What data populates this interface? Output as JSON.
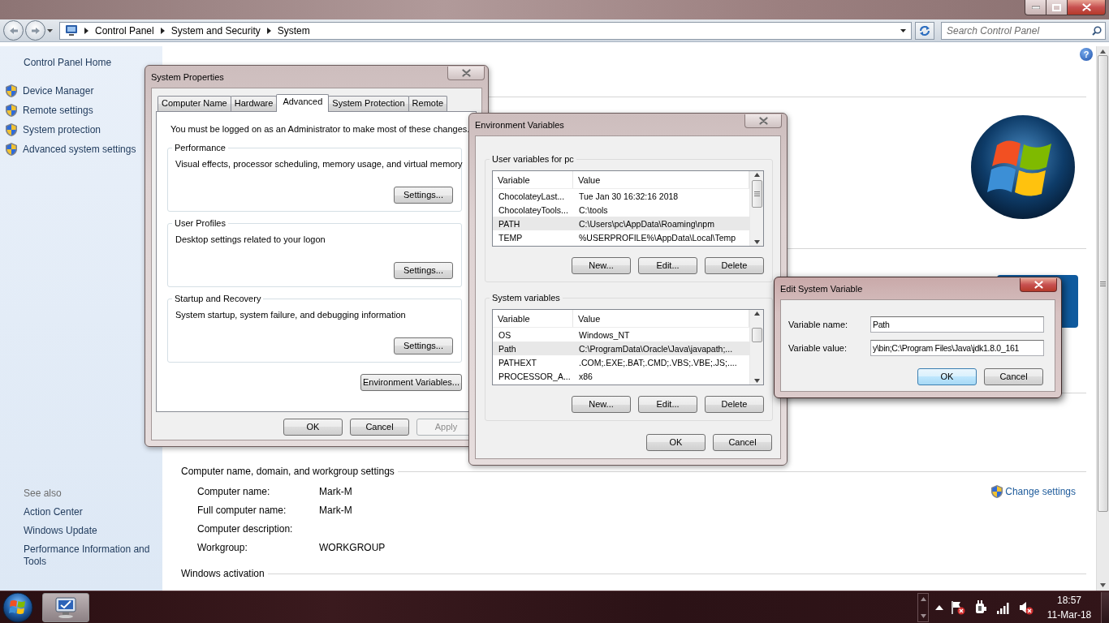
{
  "address_bar": {
    "breadcrumb": [
      "Control Panel",
      "System and Security",
      "System"
    ],
    "search": {
      "placeholder": "Search Control Panel"
    }
  },
  "help": "?",
  "sidebar": {
    "home": "Control Panel Home",
    "tasks": [
      "Device Manager",
      "Remote settings",
      "System protection",
      "Advanced system settings"
    ],
    "see_also": {
      "title": "See also",
      "links": [
        "Action Center",
        "Windows Update",
        "Performance Information and Tools"
      ]
    }
  },
  "content": {
    "computer_name": {
      "title": "Computer name, domain, and workgroup settings",
      "action": "Change settings",
      "rows": [
        {
          "label": "Computer name:",
          "value": "Mark-M"
        },
        {
          "label": "Full computer name:",
          "value": "Mark-M"
        },
        {
          "label": "Computer description:"
        },
        {
          "label": "Workgroup:",
          "value": "WORKGROUP"
        }
      ]
    },
    "activation": {
      "title": "Windows activation"
    }
  },
  "system_properties": {
    "title": "System Properties",
    "tabs": [
      {
        "label": "Computer Name",
        "selected": false
      },
      {
        "label": "Hardware",
        "selected": false
      },
      {
        "label": "Advanced",
        "selected": true
      },
      {
        "label": "System Protection",
        "selected": false
      },
      {
        "label": "Remote",
        "selected": false
      }
    ],
    "notice": "You must be logged on as an Administrator to make most of these changes.",
    "groups": [
      {
        "title": "Performance",
        "description": "Visual effects, processor scheduling, memory usage, and virtual memory",
        "button": "Settings..."
      },
      {
        "title": "User Profiles",
        "description": "Desktop settings related to your logon",
        "button": "Settings..."
      },
      {
        "title": "Startup and Recovery",
        "description": "System startup, system failure, and debugging information",
        "button": "Settings..."
      }
    ],
    "env_button": "Environment Variables...",
    "buttons": [
      {
        "label": "OK",
        "disabled": false
      },
      {
        "label": "Cancel",
        "disabled": false
      },
      {
        "label": "Apply",
        "disabled": true
      }
    ]
  },
  "environment_variables": {
    "title": "Environment Variables",
    "groups": [
      {
        "title": "User variables for pc",
        "columns": [
          "Variable",
          "Value"
        ],
        "rows": [
          {
            "variable": "ChocolateyLast...",
            "value": "Tue Jan 30 16:32:16 2018",
            "selected": false
          },
          {
            "variable": "ChocolateyTools...",
            "value": "C:\\tools",
            "selected": false
          },
          {
            "variable": "PATH",
            "value": "C:\\Users\\pc\\AppData\\Roaming\\npm",
            "selected": true
          },
          {
            "variable": "TEMP",
            "value": "%USERPROFILE%\\AppData\\Local\\Temp",
            "selected": false
          }
        ],
        "buttons": [
          "New...",
          "Edit...",
          "Delete"
        ]
      },
      {
        "title": "System variables",
        "columns": [
          "Variable",
          "Value"
        ],
        "rows": [
          {
            "variable": "OS",
            "value": "Windows_NT",
            "selected": false
          },
          {
            "variable": "Path",
            "value": "C:\\ProgramData\\Oracle\\Java\\javapath;...",
            "selected": true
          },
          {
            "variable": "PATHEXT",
            "value": ".COM;.EXE;.BAT;.CMD;.VBS;.VBE;.JS;....",
            "selected": false
          },
          {
            "variable": "PROCESSOR_A...",
            "value": "x86",
            "selected": false
          }
        ],
        "buttons": [
          "New...",
          "Edit...",
          "Delete"
        ]
      }
    ],
    "buttons": [
      "OK",
      "Cancel"
    ]
  },
  "edit_variable": {
    "title": "Edit System Variable",
    "fields": [
      {
        "label": "Variable name:",
        "value": "Path"
      },
      {
        "label": "Variable value:",
        "value": "y\\bin;C:\\Program Files\\Java\\jdk1.8.0_161"
      }
    ],
    "buttons": [
      {
        "label": "OK",
        "default": true
      },
      {
        "label": "Cancel",
        "default": false
      }
    ]
  },
  "taskbar": {
    "time": "18:57",
    "date": "11-Mar-18"
  }
}
